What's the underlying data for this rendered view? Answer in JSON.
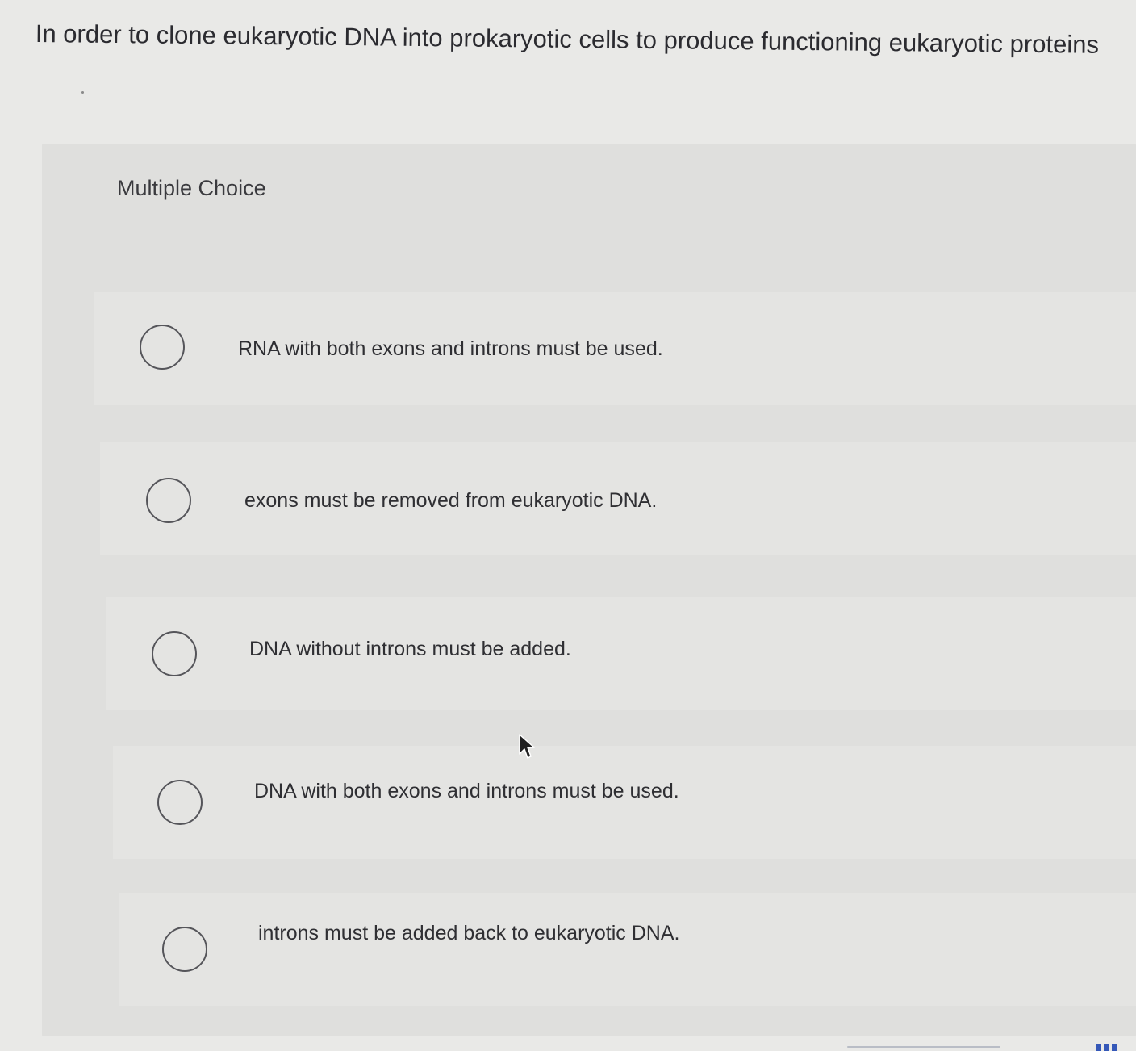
{
  "question": {
    "text": "In order to clone eukaryotic DNA into prokaryotic cells to produce functioning eukaryotic proteins"
  },
  "multiple_choice": {
    "label": "Multiple Choice",
    "options": [
      {
        "label": "RNA with both exons and introns must be used.",
        "selected": false
      },
      {
        "label": "exons must be removed from eukaryotic DNA.",
        "selected": false
      },
      {
        "label": "DNA without introns must be added.",
        "selected": false
      },
      {
        "label": "DNA with both exons and introns must be used.",
        "selected": false
      },
      {
        "label": "introns must be added back to eukaryotic DNA.",
        "selected": false
      }
    ]
  },
  "icons": {
    "option_marker": "radio-circle-icon",
    "pointer": "mouse-pointer-icon"
  },
  "colors": {
    "page_background": "#e9e9e7",
    "panel_background": "#dfdfdd",
    "option_background": "#e4e4e2",
    "text": "#2f2f33",
    "radio_border": "#55555a"
  }
}
